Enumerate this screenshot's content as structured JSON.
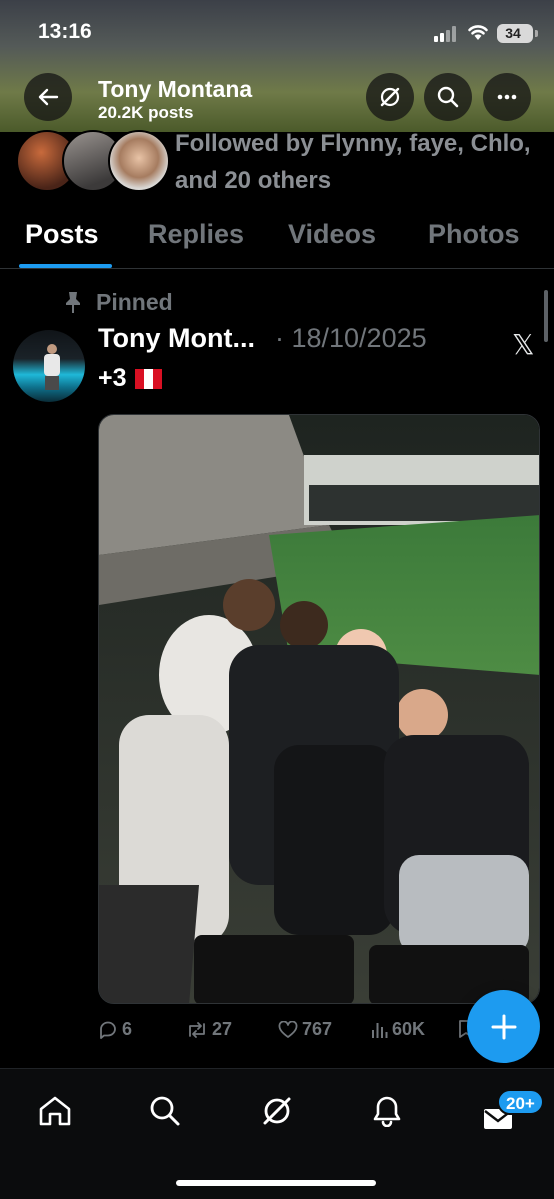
{
  "status_bar": {
    "time": "13:16",
    "battery": "34"
  },
  "header": {
    "name": "Tony Montana",
    "posts_count": "20.2K posts"
  },
  "profile": {
    "followed_by": "Followed by Flynny, faye, Chlo, and 20 others"
  },
  "tabs": [
    {
      "label": "Posts",
      "active": true
    },
    {
      "label": "Replies",
      "active": false
    },
    {
      "label": "Videos",
      "active": false
    },
    {
      "label": "Photos",
      "active": false
    }
  ],
  "post": {
    "pinned_label": "Pinned",
    "author": "Tony Mont...",
    "date": "· 18/10/2025",
    "text": "+3",
    "flag_icon": "peru-flag-icon",
    "actions": {
      "replies": "6",
      "reposts": "27",
      "likes": "767",
      "views": "60K"
    }
  },
  "bottom_nav": {
    "messages_badge": "20+"
  },
  "colors": {
    "accent": "#1d9bf0",
    "muted": "#71767b",
    "background": "#000000"
  }
}
